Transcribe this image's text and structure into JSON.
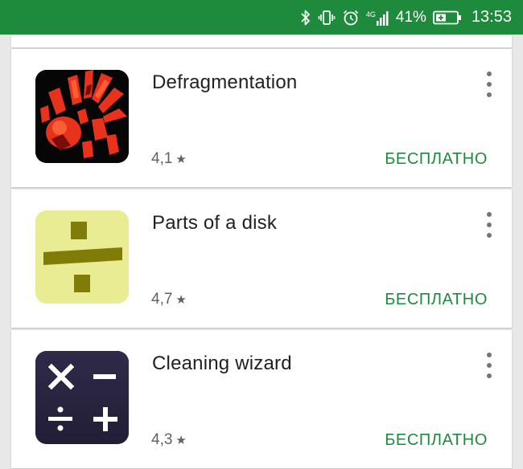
{
  "status_bar": {
    "network": "4G",
    "battery_percent": "41%",
    "time": "13:53",
    "background_color": "#1e8a3c",
    "icons": [
      "bluetooth-icon",
      "vibrate-icon",
      "alarm-icon",
      "signal-icon",
      "battery-charging-icon"
    ]
  },
  "apps": [
    {
      "title": "Defragmentation",
      "rating": "4,1",
      "price": "БЕСПЛАТНО",
      "icon": "defragmentation-app-icon"
    },
    {
      "title": "Parts of a disk",
      "rating": "4,7",
      "price": "БЕСПЛАТНО",
      "icon": "parts-of-a-disk-app-icon"
    },
    {
      "title": "Cleaning wizard",
      "rating": "4,3",
      "price": "БЕСПЛАТНО",
      "icon": "cleaning-wizard-app-icon"
    }
  ],
  "colors": {
    "accent_green": "#1e8a3c",
    "title_text": "#212121",
    "secondary_text": "#616161"
  }
}
